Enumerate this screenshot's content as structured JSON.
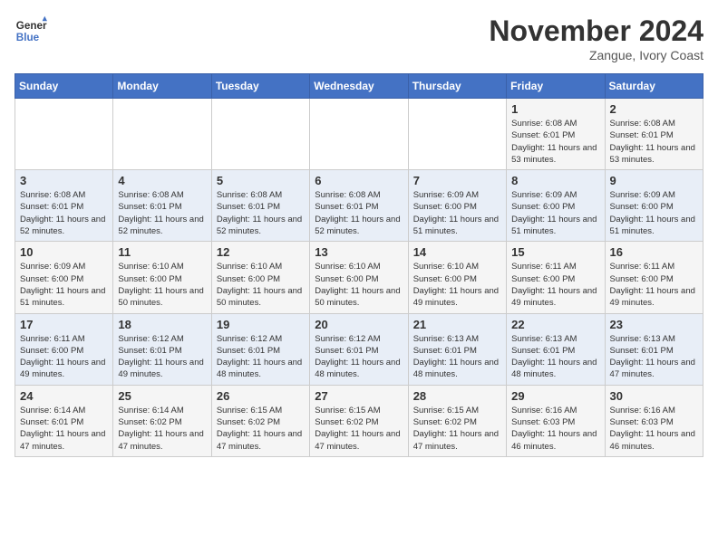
{
  "header": {
    "logo_general": "General",
    "logo_blue": "Blue",
    "month_title": "November 2024",
    "location": "Zangue, Ivory Coast"
  },
  "weekdays": [
    "Sunday",
    "Monday",
    "Tuesday",
    "Wednesday",
    "Thursday",
    "Friday",
    "Saturday"
  ],
  "weeks": [
    [
      {
        "day": "",
        "info": ""
      },
      {
        "day": "",
        "info": ""
      },
      {
        "day": "",
        "info": ""
      },
      {
        "day": "",
        "info": ""
      },
      {
        "day": "",
        "info": ""
      },
      {
        "day": "1",
        "info": "Sunrise: 6:08 AM\nSunset: 6:01 PM\nDaylight: 11 hours and 53 minutes."
      },
      {
        "day": "2",
        "info": "Sunrise: 6:08 AM\nSunset: 6:01 PM\nDaylight: 11 hours and 53 minutes."
      }
    ],
    [
      {
        "day": "3",
        "info": "Sunrise: 6:08 AM\nSunset: 6:01 PM\nDaylight: 11 hours and 52 minutes."
      },
      {
        "day": "4",
        "info": "Sunrise: 6:08 AM\nSunset: 6:01 PM\nDaylight: 11 hours and 52 minutes."
      },
      {
        "day": "5",
        "info": "Sunrise: 6:08 AM\nSunset: 6:01 PM\nDaylight: 11 hours and 52 minutes."
      },
      {
        "day": "6",
        "info": "Sunrise: 6:08 AM\nSunset: 6:01 PM\nDaylight: 11 hours and 52 minutes."
      },
      {
        "day": "7",
        "info": "Sunrise: 6:09 AM\nSunset: 6:00 PM\nDaylight: 11 hours and 51 minutes."
      },
      {
        "day": "8",
        "info": "Sunrise: 6:09 AM\nSunset: 6:00 PM\nDaylight: 11 hours and 51 minutes."
      },
      {
        "day": "9",
        "info": "Sunrise: 6:09 AM\nSunset: 6:00 PM\nDaylight: 11 hours and 51 minutes."
      }
    ],
    [
      {
        "day": "10",
        "info": "Sunrise: 6:09 AM\nSunset: 6:00 PM\nDaylight: 11 hours and 51 minutes."
      },
      {
        "day": "11",
        "info": "Sunrise: 6:10 AM\nSunset: 6:00 PM\nDaylight: 11 hours and 50 minutes."
      },
      {
        "day": "12",
        "info": "Sunrise: 6:10 AM\nSunset: 6:00 PM\nDaylight: 11 hours and 50 minutes."
      },
      {
        "day": "13",
        "info": "Sunrise: 6:10 AM\nSunset: 6:00 PM\nDaylight: 11 hours and 50 minutes."
      },
      {
        "day": "14",
        "info": "Sunrise: 6:10 AM\nSunset: 6:00 PM\nDaylight: 11 hours and 49 minutes."
      },
      {
        "day": "15",
        "info": "Sunrise: 6:11 AM\nSunset: 6:00 PM\nDaylight: 11 hours and 49 minutes."
      },
      {
        "day": "16",
        "info": "Sunrise: 6:11 AM\nSunset: 6:00 PM\nDaylight: 11 hours and 49 minutes."
      }
    ],
    [
      {
        "day": "17",
        "info": "Sunrise: 6:11 AM\nSunset: 6:00 PM\nDaylight: 11 hours and 49 minutes."
      },
      {
        "day": "18",
        "info": "Sunrise: 6:12 AM\nSunset: 6:01 PM\nDaylight: 11 hours and 49 minutes."
      },
      {
        "day": "19",
        "info": "Sunrise: 6:12 AM\nSunset: 6:01 PM\nDaylight: 11 hours and 48 minutes."
      },
      {
        "day": "20",
        "info": "Sunrise: 6:12 AM\nSunset: 6:01 PM\nDaylight: 11 hours and 48 minutes."
      },
      {
        "day": "21",
        "info": "Sunrise: 6:13 AM\nSunset: 6:01 PM\nDaylight: 11 hours and 48 minutes."
      },
      {
        "day": "22",
        "info": "Sunrise: 6:13 AM\nSunset: 6:01 PM\nDaylight: 11 hours and 48 minutes."
      },
      {
        "day": "23",
        "info": "Sunrise: 6:13 AM\nSunset: 6:01 PM\nDaylight: 11 hours and 47 minutes."
      }
    ],
    [
      {
        "day": "24",
        "info": "Sunrise: 6:14 AM\nSunset: 6:01 PM\nDaylight: 11 hours and 47 minutes."
      },
      {
        "day": "25",
        "info": "Sunrise: 6:14 AM\nSunset: 6:02 PM\nDaylight: 11 hours and 47 minutes."
      },
      {
        "day": "26",
        "info": "Sunrise: 6:15 AM\nSunset: 6:02 PM\nDaylight: 11 hours and 47 minutes."
      },
      {
        "day": "27",
        "info": "Sunrise: 6:15 AM\nSunset: 6:02 PM\nDaylight: 11 hours and 47 minutes."
      },
      {
        "day": "28",
        "info": "Sunrise: 6:15 AM\nSunset: 6:02 PM\nDaylight: 11 hours and 47 minutes."
      },
      {
        "day": "29",
        "info": "Sunrise: 6:16 AM\nSunset: 6:03 PM\nDaylight: 11 hours and 46 minutes."
      },
      {
        "day": "30",
        "info": "Sunrise: 6:16 AM\nSunset: 6:03 PM\nDaylight: 11 hours and 46 minutes."
      }
    ]
  ]
}
